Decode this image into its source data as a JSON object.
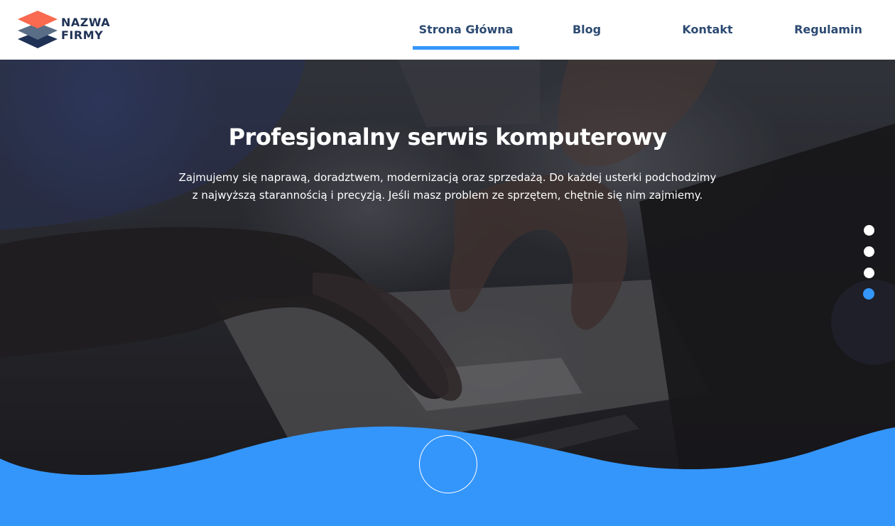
{
  "brand": {
    "line1": "NAZWA",
    "line2": "FIRMY",
    "colors": {
      "top": "#f96a50",
      "middle": "#596d86",
      "bottom": "#1f3256"
    }
  },
  "nav": {
    "items": [
      {
        "label": "Strona Główna",
        "active": true
      },
      {
        "label": "Blog",
        "active": false
      },
      {
        "label": "Kontakt",
        "active": false
      },
      {
        "label": "Regulamin",
        "active": false
      }
    ]
  },
  "hero": {
    "title": "Profesjonalny serwis komputerowy",
    "description": "Zajmujemy się naprawą, doradztwem, modernizacją oraz sprzedażą. Do każdej usterki podchodzimy z najwyższą starannością i precyzją. Jeśli masz problem ze sprzętem, chętnie się nim zajmiemy.",
    "background_icon": "hands-on-laptop-photo"
  },
  "slider": {
    "slide_count": 4,
    "active_slide": 4
  },
  "scroll_button": {
    "icon": "circle-outline-icon"
  },
  "colors": {
    "accent": "#3496fb",
    "nav_text": "#2c4a72",
    "white": "#ffffff"
  }
}
